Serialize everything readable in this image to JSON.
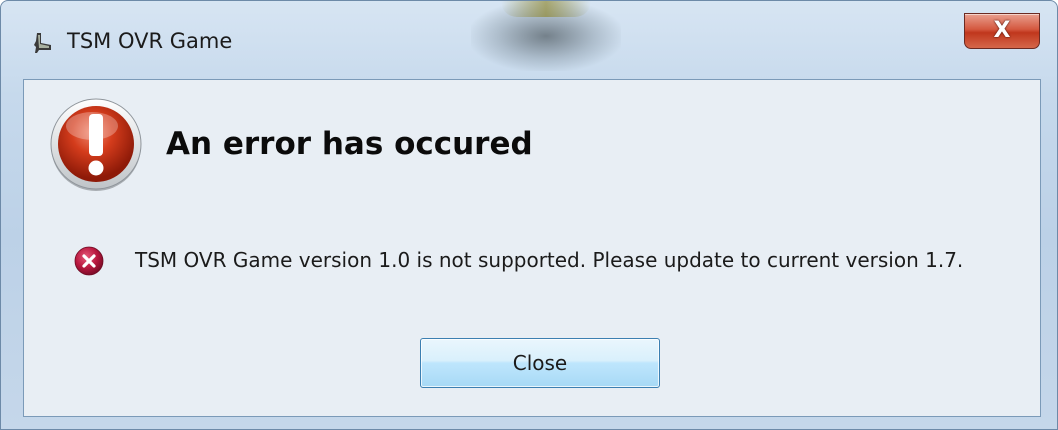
{
  "window": {
    "title": "TSM OVR Game",
    "close_glyph": "X"
  },
  "dialog": {
    "heading": "An error has occured",
    "message": "TSM OVR Game version 1.0 is not supported. Please update to current version 1.7.",
    "close_label": "Close",
    "icons": {
      "app": "app-icon",
      "main": "exclamation-icon",
      "message": "error-x-icon"
    }
  },
  "colors": {
    "error_red": "#c0371d",
    "button_border": "#3c7fb1"
  }
}
